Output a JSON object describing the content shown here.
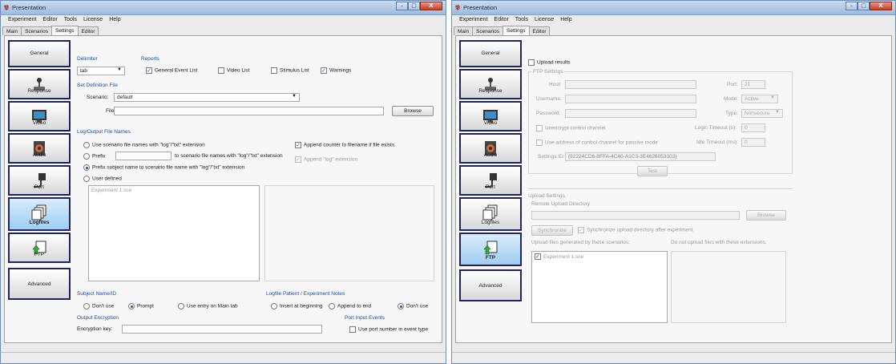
{
  "app": {
    "title": "Presentation",
    "menu": [
      "Experiment",
      "Editor",
      "Tools",
      "License",
      "Help"
    ],
    "tabs": [
      "Main",
      "Scenarios",
      "Settings",
      "Editor"
    ],
    "active_tab": "Settings",
    "window_buttons": [
      "–",
      "▢",
      "X"
    ]
  },
  "sidebar": [
    "General",
    "Response",
    "Video",
    "Audio",
    "Port",
    "Logfiles",
    "FTP",
    "Advanced"
  ],
  "left": {
    "active_sidebar": "Logfiles",
    "delimiter": {
      "label": "Delimiter",
      "value": "tab"
    },
    "reports": {
      "label": "Reports",
      "items": [
        {
          "label": "General Event List",
          "checked": true
        },
        {
          "label": "Video List",
          "checked": false
        },
        {
          "label": "Stimulus List",
          "checked": false
        },
        {
          "label": "Warnings",
          "checked": true
        }
      ]
    },
    "set_definition": {
      "title": "Set Definition File",
      "scenario_label": "Scenario:",
      "scenario_value": "default",
      "file_label": "File:",
      "file_value": "",
      "browse": "Browse"
    },
    "log_names": {
      "title": "Log/Output File Names",
      "options": [
        {
          "label": "Use scenario file names with \"log\"/\"txt\" extension",
          "selected": false
        },
        {
          "label": "Prefix",
          "selected": false
        },
        {
          "label": "Prefix subject name to scenario file name with \"log\"/\"txt\" extension",
          "selected": true
        },
        {
          "label": "User defined",
          "selected": false
        }
      ],
      "prefix_suffix": "to scenario file names with \"log\"/\"txt\" extension",
      "append_counter": "Append counter to filename if file exists",
      "append_log": "Append \"log\" extension",
      "list_item": "Experiment 1.sce"
    },
    "subject": {
      "title": "Subject Name/ID",
      "options": [
        {
          "label": "Don't use",
          "selected": false
        },
        {
          "label": "Prompt",
          "selected": true
        },
        {
          "label": "Use entry on Main tab",
          "selected": false
        }
      ]
    },
    "notes": {
      "title": "Logfile Patient / Experiment Notes",
      "options": [
        {
          "label": "Insert at beginning",
          "selected": false
        },
        {
          "label": "Append to end",
          "selected": false
        },
        {
          "label": "Don't use",
          "selected": true
        }
      ]
    },
    "encryption": {
      "title": "Output Encryption",
      "key_label": "Encryption key:",
      "key_value": ""
    },
    "port_events": {
      "title": "Port Input Events",
      "label": "Use port number in event type"
    }
  },
  "right": {
    "active_sidebar": "FTP",
    "upload_results": "Upload results",
    "ftp_settings": {
      "title": "FTP Settings",
      "host_label": "Host:",
      "host_value": "",
      "port_label": "Port:",
      "port_value": "21",
      "username_label": "Username:",
      "password_label": "Password:",
      "mode_label": "Mode:",
      "mode_value": "Active",
      "type_label": "Type:",
      "type_value": "Nonsecure",
      "unencrypt_label": "Unencrypt control channel",
      "use_address_label": "Use address of control channel for passive mode",
      "login_timeout_label": "Login Timeout (s):",
      "login_timeout_value": "0",
      "idle_timeout_label": "Idle Timeout (ms):",
      "idle_timeout_value": "0",
      "settings_id_label": "Settings ID:",
      "settings_id_value": "{92224CD6-8FFA-4C40-A1C3-3E4626053303}",
      "test": "Test"
    },
    "upload_settings": {
      "title": "Upload Settings",
      "remote_dir_label": "Remote Upload Directory",
      "remote_dir_value": "",
      "browse": "Browse",
      "synchronize": "Synchronize",
      "sync_after": "Synchronize upload directory after experiment",
      "upload_files_label": "Upload files generated by these scenarios:",
      "no_upload_label": "Do not upload files with these extensions:",
      "file_item": "Experiment 1.sce"
    }
  }
}
